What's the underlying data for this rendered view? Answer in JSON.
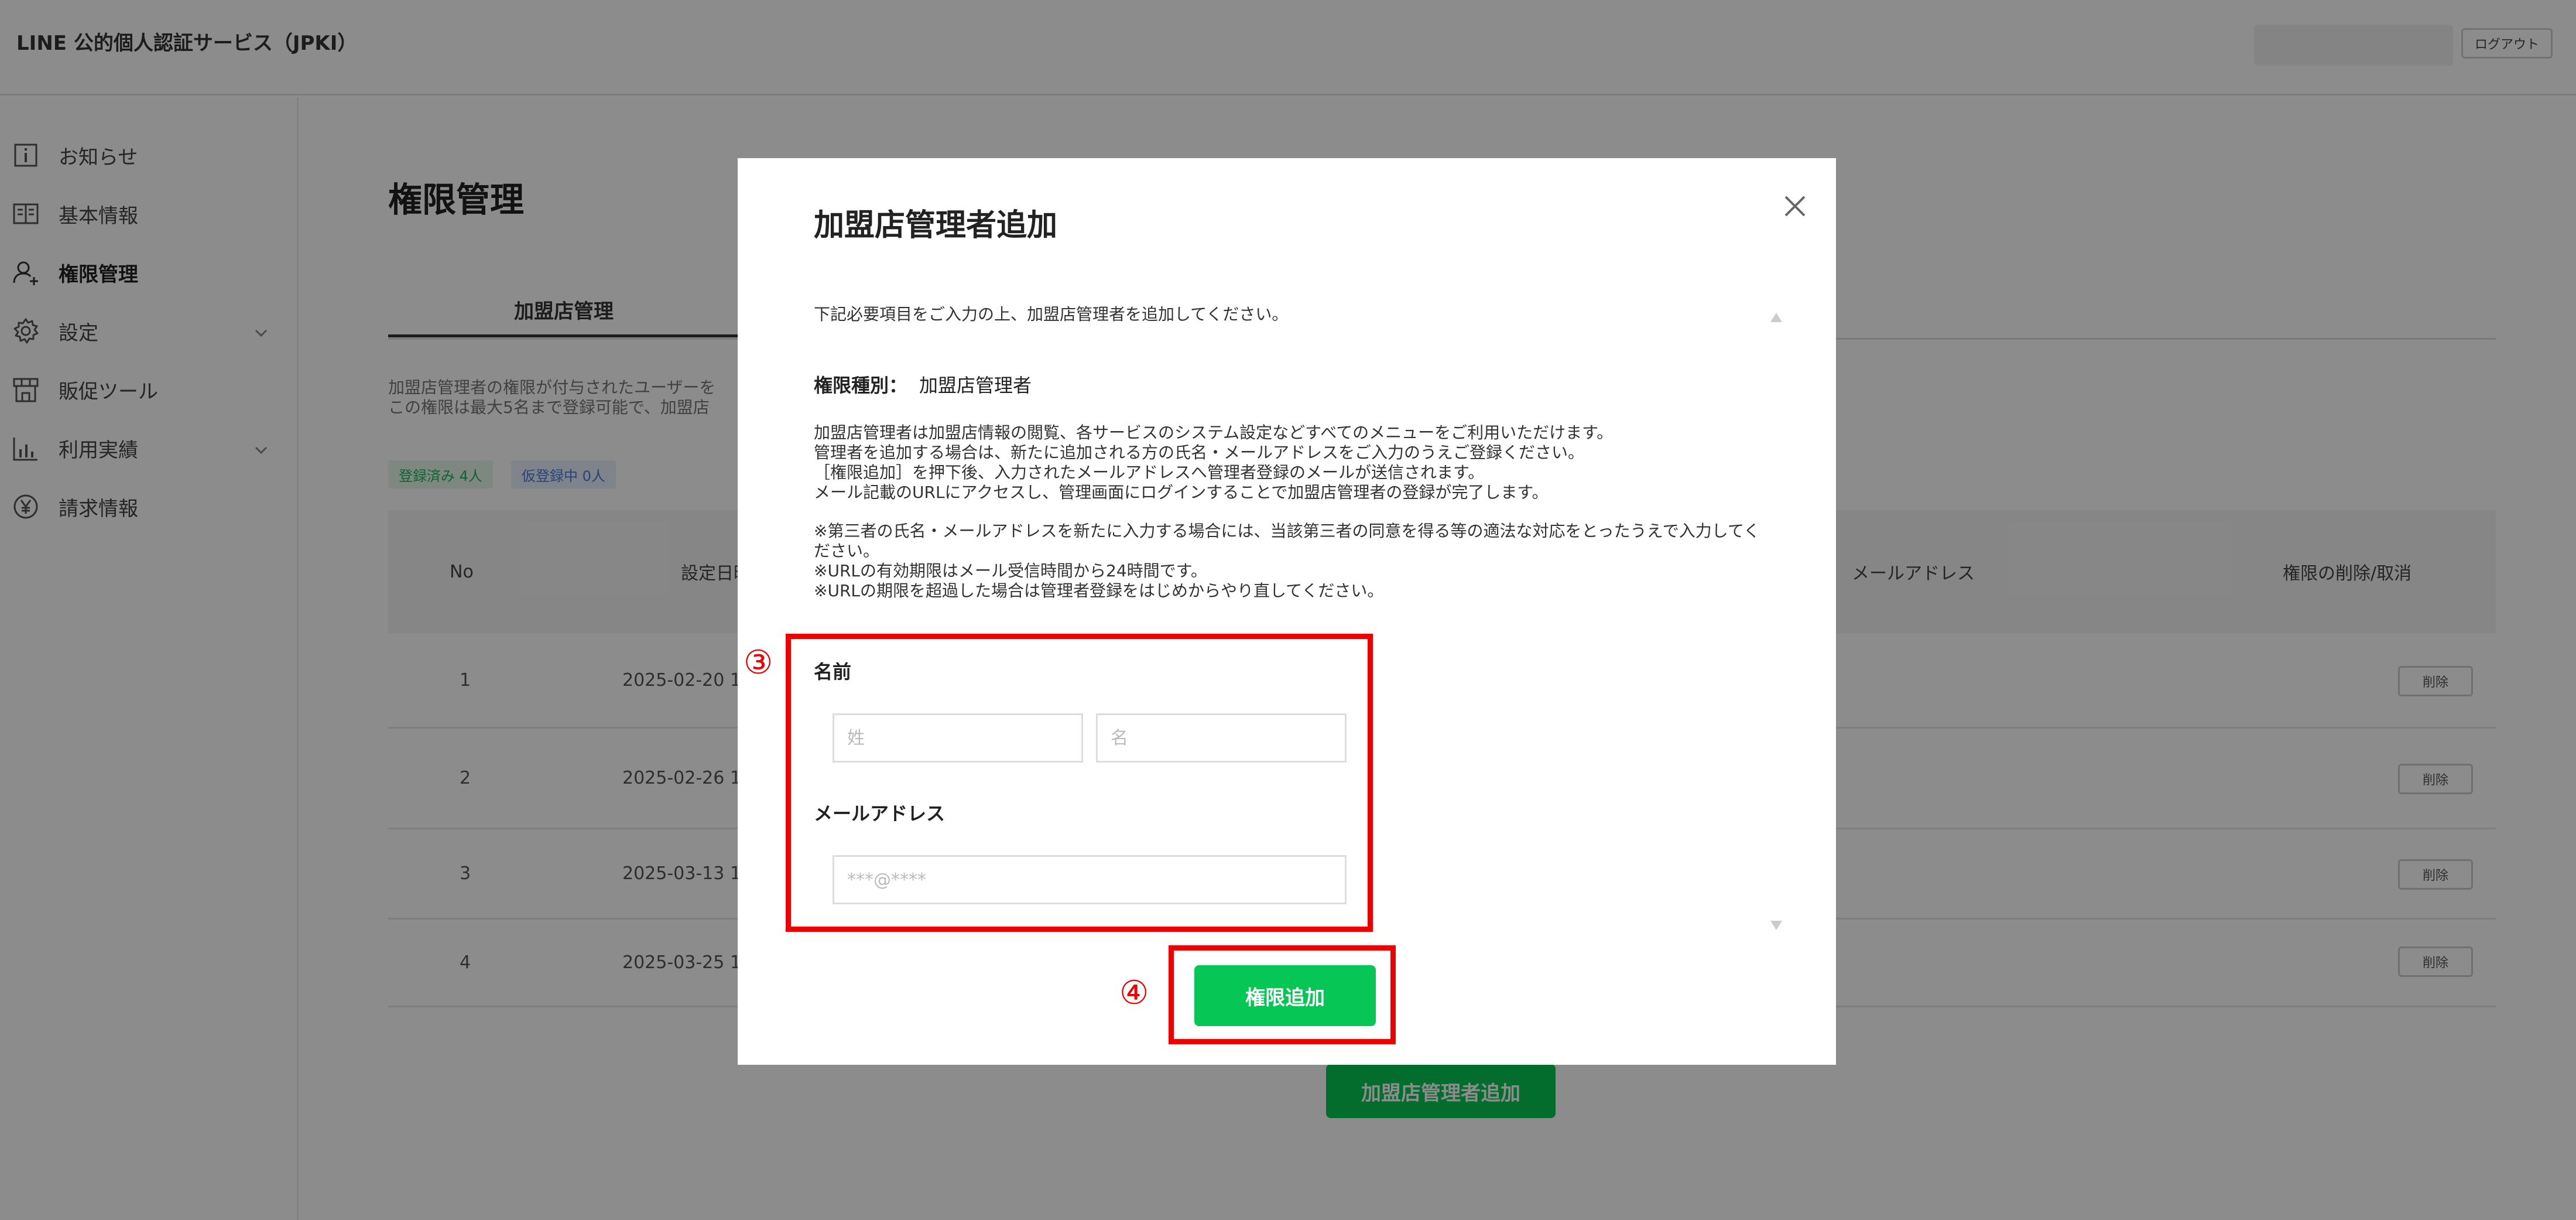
{
  "app": {
    "title": "LINE 公的個人認証サービス（JPKI）",
    "logout_label": "ログアウト"
  },
  "sidebar": {
    "items": [
      {
        "label": "お知らせ",
        "icon": "info-icon",
        "active": false,
        "expandable": false
      },
      {
        "label": "基本情報",
        "icon": "book-icon",
        "active": false,
        "expandable": false
      },
      {
        "label": "権限管理",
        "icon": "user-add-icon",
        "active": true,
        "expandable": false
      },
      {
        "label": "設定",
        "icon": "gear-icon",
        "active": false,
        "expandable": true
      },
      {
        "label": "販促ツール",
        "icon": "store-icon",
        "active": false,
        "expandable": false
      },
      {
        "label": "利用実績",
        "icon": "chart-icon",
        "active": false,
        "expandable": true
      },
      {
        "label": "請求情報",
        "icon": "yen-icon",
        "active": false,
        "expandable": false
      }
    ]
  },
  "page": {
    "title": "権限管理",
    "tab_label": "加盟店管理",
    "description_lines": [
      "加盟店管理者の権限が付与されたユーザーを",
      "この権限は最大5名まで登録可能で、加盟店"
    ],
    "badge_registered": "登録済み 4人",
    "badge_pending": "仮登録中 0人",
    "table": {
      "headers": {
        "no": "No",
        "set_date": "設定日時",
        "email": "メールアドレス",
        "action": "権限の削除/取消"
      },
      "rows": [
        {
          "no": "1",
          "date": "2025-02-20 1",
          "action": "削除"
        },
        {
          "no": "2",
          "date": "2025-02-26 1",
          "action": "削除"
        },
        {
          "no": "3",
          "date": "2025-03-13 1",
          "action": "削除"
        },
        {
          "no": "4",
          "date": "2025-03-25 1",
          "action": "削除"
        }
      ]
    },
    "add_button_label": "加盟店管理者追加"
  },
  "modal": {
    "title": "加盟店管理者追加",
    "lead": "下記必要項目をご入力の上、加盟店管理者を追加してください。",
    "kind_label": "権限種別：",
    "kind_value": "加盟店管理者",
    "body_lines": [
      "加盟店管理者は加盟店情報の閲覧、各サービスのシステム設定などすべてのメニューをご利用いただけます。",
      "管理者を追加する場合は、新たに追加される方の氏名・メールアドレスをご入力のうえご登録ください。",
      "［権限追加］を押下後、入力されたメールアドレスへ管理者登録のメールが送信されます。",
      "メール記載のURLにアクセスし、管理画面にログインすることで加盟店管理者の登録が完了します。"
    ],
    "note_lines": [
      "※第三者の氏名・メールアドレスを新たに入力する場合には、当該第三者の同意を得る等の適法な対応をとったうえで入力してく",
      "ださい。",
      "※URLの有効期限はメール受信時間から24時間です。",
      "※URLの期限を超過した場合は管理者登録をはじめからやり直してください。"
    ],
    "name_label": "名前",
    "last_name_placeholder": "姓",
    "first_name_placeholder": "名",
    "email_label": "メールアドレス",
    "email_placeholder": "***@****",
    "submit_label": "権限追加"
  },
  "annotations": {
    "step3": "③",
    "step4": "④",
    "color": "#ee0000"
  },
  "colors": {
    "accent": "#06c755",
    "overlay": "rgba(0,0,0,0.45)"
  }
}
